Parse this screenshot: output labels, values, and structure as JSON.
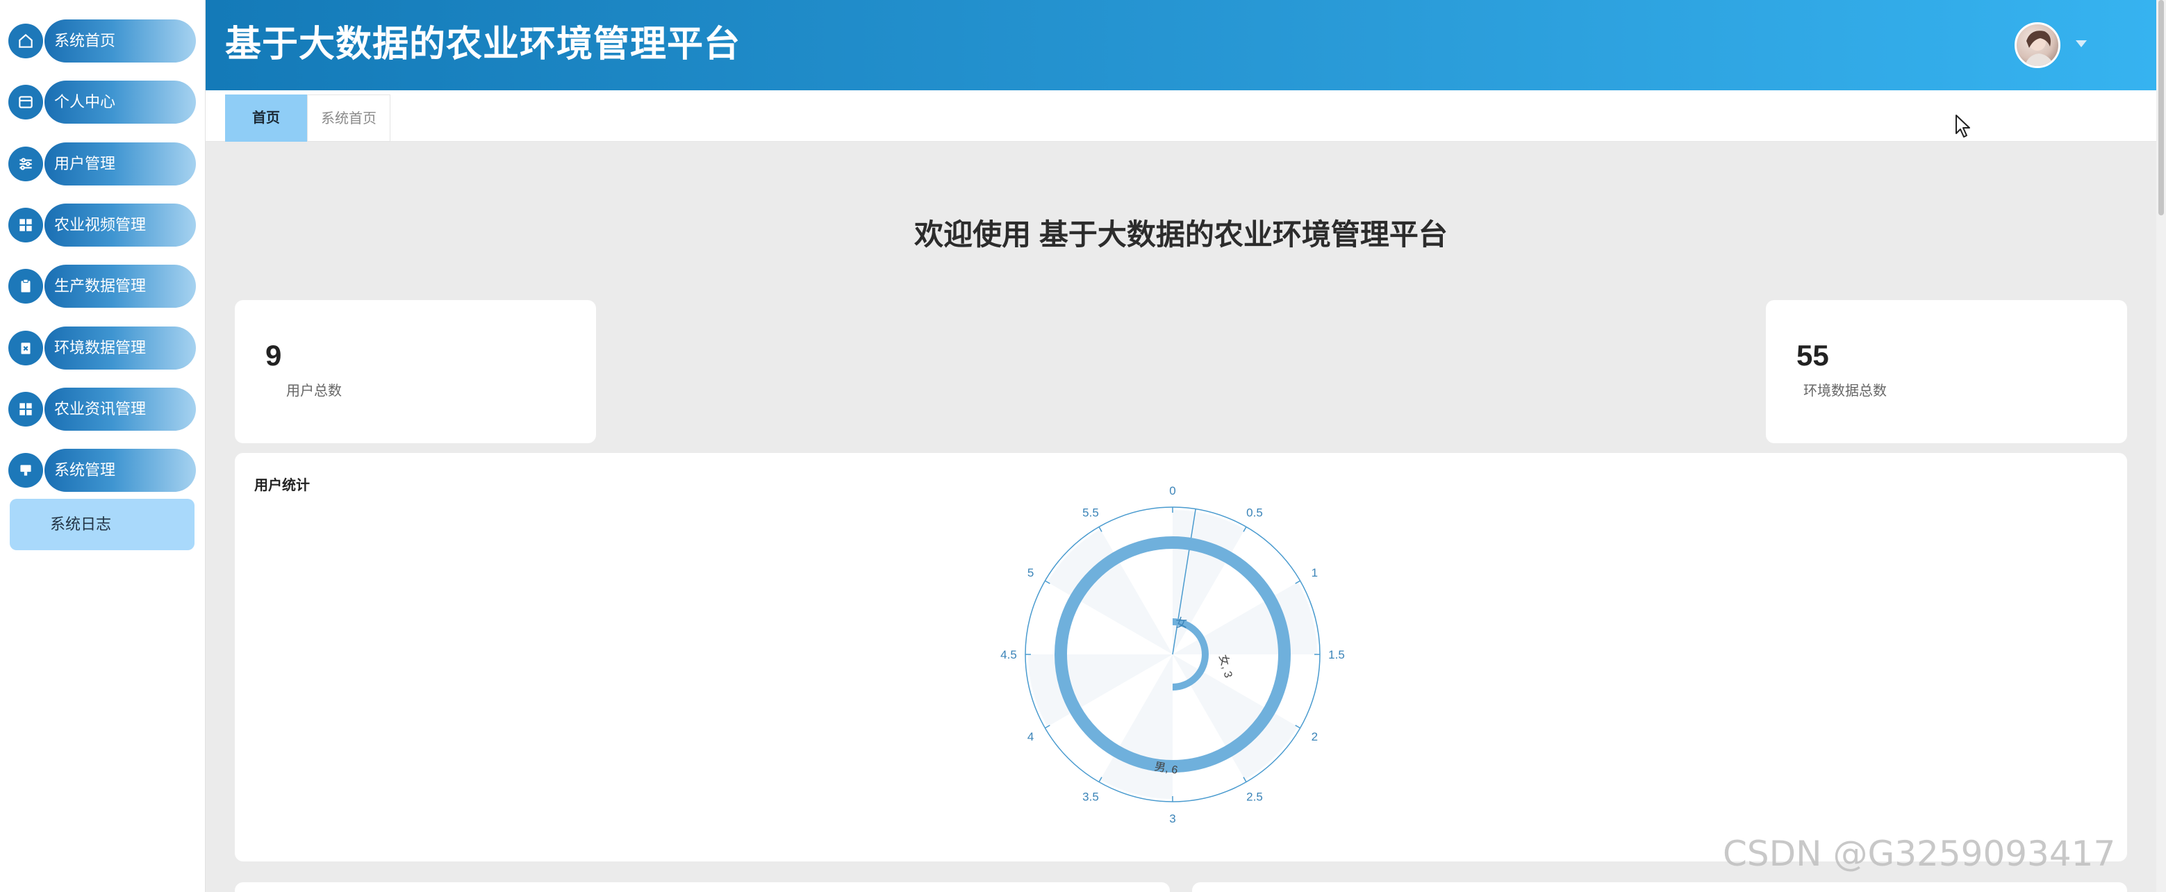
{
  "app": {
    "title": "基于大数据的农业环境管理平台"
  },
  "sidebar": {
    "items": [
      {
        "label": "系统首页",
        "icon": "home-icon"
      },
      {
        "label": "个人中心",
        "icon": "id-card-icon"
      },
      {
        "label": "用户管理",
        "icon": "sliders-icon"
      },
      {
        "label": "农业视频管理",
        "icon": "grid-icon"
      },
      {
        "label": "生产数据管理",
        "icon": "clipboard-icon"
      },
      {
        "label": "环境数据管理",
        "icon": "clipboard-x-icon"
      },
      {
        "label": "农业资讯管理",
        "icon": "grid-icon"
      },
      {
        "label": "系统管理",
        "icon": "monitor-icon"
      }
    ],
    "sub_item": "系统日志"
  },
  "tabs": [
    {
      "label": "首页"
    },
    {
      "label": "系统首页"
    }
  ],
  "welcome": "欢迎使用 基于大数据的农业环境管理平台",
  "stats": [
    {
      "value": "9",
      "label": "用户总数"
    },
    {
      "value": "55",
      "label": "环境数据总数"
    }
  ],
  "chart_card_title": "用户统计",
  "chart_data": {
    "type": "polar-bar",
    "title": "用户统计",
    "angle_axis": {
      "min": 0,
      "max": 6,
      "ticks": [
        "0",
        "0.5",
        "1",
        "1.5",
        "2",
        "2.5",
        "3",
        "3.5",
        "4",
        "4.5",
        "5",
        "5.5"
      ]
    },
    "categories": [
      "女",
      "男"
    ],
    "values": [
      3,
      6
    ],
    "data_labels": [
      "女, 3",
      "男, 6"
    ],
    "color": "#6fb0dc"
  },
  "watermark": "CSDN @G3259093417"
}
